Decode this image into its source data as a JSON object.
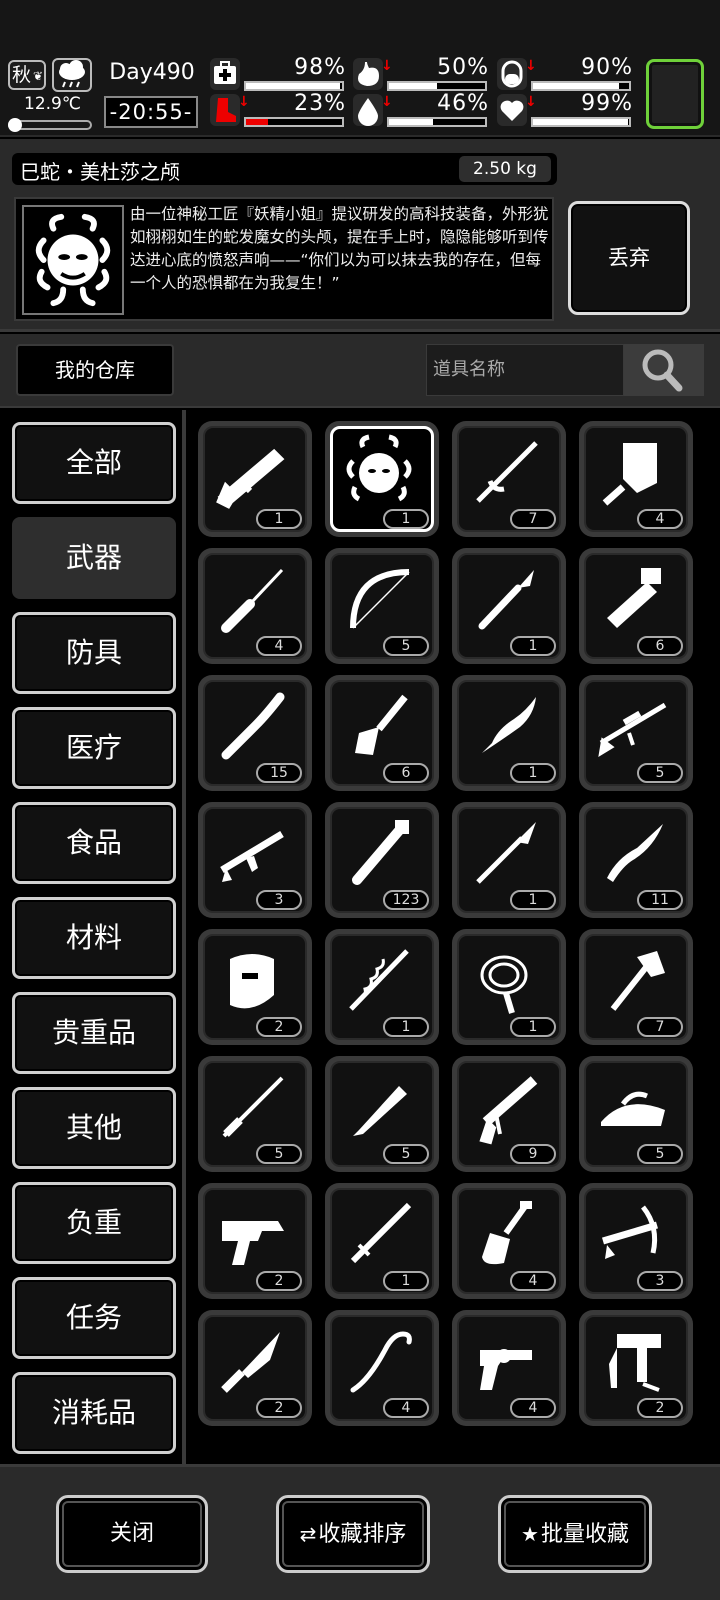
{
  "status": {
    "season": "秋",
    "temperature": "12.9℃",
    "day": "Day490",
    "time": "-20:55-",
    "stats": [
      {
        "icon": "medkit-icon",
        "value": "98%",
        "level": 0.98,
        "down": false,
        "red": false
      },
      {
        "icon": "stomach-icon",
        "value": "50%",
        "level": 0.5,
        "down": true,
        "red": false
      },
      {
        "icon": "pill-icon",
        "value": "90%",
        "level": 0.9,
        "down": true,
        "red": false
      },
      {
        "icon": "boot-icon",
        "value": "23%",
        "level": 0.23,
        "down": true,
        "red": true
      },
      {
        "icon": "water-drop-icon",
        "value": "46%",
        "level": 0.46,
        "down": true,
        "red": false
      },
      {
        "icon": "heart-icon",
        "value": "99%",
        "level": 0.99,
        "down": true,
        "red": false
      }
    ]
  },
  "detail": {
    "name": "巳蛇・美杜莎之颅",
    "weight": "2.50 kg",
    "description": "由一位神秘工匠『妖精小姐』提议研发的高科技装备，外形犹如栩栩如生的蛇发魔女的头颅，提在手上时，隐隐能够听到传达进心底的愤怒声响——“你们以为可以抹去我的存在，但每一个人的恐惧都在为我复生！”",
    "discard_label": "丢弃"
  },
  "search": {
    "warehouse_label": "我的仓库",
    "placeholder": "道具名称"
  },
  "categories": [
    "全部",
    "武器",
    "防具",
    "医疗",
    "食品",
    "材料",
    "贵重品",
    "其他",
    "负重",
    "任务",
    "消耗品"
  ],
  "active_category": 1,
  "items": [
    {
      "icon": "caulk-gun-rifle-icon",
      "count": "1"
    },
    {
      "icon": "medusa-head-icon",
      "count": "1",
      "selected": true
    },
    {
      "icon": "rapier-icon",
      "count": "7"
    },
    {
      "icon": "cleaver-icon",
      "count": "4"
    },
    {
      "icon": "screwdriver-icon",
      "count": "4"
    },
    {
      "icon": "bow-icon",
      "count": "5"
    },
    {
      "icon": "scalpel-icon",
      "count": "1"
    },
    {
      "icon": "pipe-wrench-icon",
      "count": "6"
    },
    {
      "icon": "wooden-club-icon",
      "count": "15"
    },
    {
      "icon": "shovel-blade-icon",
      "count": "6"
    },
    {
      "icon": "ornate-dagger-icon",
      "count": "1"
    },
    {
      "icon": "sniper-rifle-icon",
      "count": "5"
    },
    {
      "icon": "assault-rifle-icon",
      "count": "3"
    },
    {
      "icon": "baton-icon",
      "count": "123"
    },
    {
      "icon": "spear-icon",
      "count": "1"
    },
    {
      "icon": "folding-knife-icon",
      "count": "11"
    },
    {
      "icon": "riot-shield-icon",
      "count": "2"
    },
    {
      "icon": "vine-staff-icon",
      "count": "1"
    },
    {
      "icon": "whip-icon",
      "count": "1"
    },
    {
      "icon": "axe-icon",
      "count": "7"
    },
    {
      "icon": "katana-icon",
      "count": "5"
    },
    {
      "icon": "baseball-bat-icon",
      "count": "5"
    },
    {
      "icon": "caulking-gun-icon",
      "count": "9"
    },
    {
      "icon": "iron-icon",
      "count": "5"
    },
    {
      "icon": "blaster-pistol-icon",
      "count": "2"
    },
    {
      "icon": "long-sword-icon",
      "count": "1"
    },
    {
      "icon": "spade-icon",
      "count": "4"
    },
    {
      "icon": "crossbow-icon",
      "count": "3"
    },
    {
      "icon": "combat-knife-icon",
      "count": "2"
    },
    {
      "icon": "crowbar-icon",
      "count": "4"
    },
    {
      "icon": "revolver-icon",
      "count": "4"
    },
    {
      "icon": "nail-gun-icon",
      "count": "2"
    }
  ],
  "bottom": {
    "close_label": "关闭",
    "sort_label": "收藏排序",
    "batch_label": "批量收藏"
  },
  "colors": {
    "accent_green": "#6fd13a",
    "warning_red": "#e00000"
  }
}
